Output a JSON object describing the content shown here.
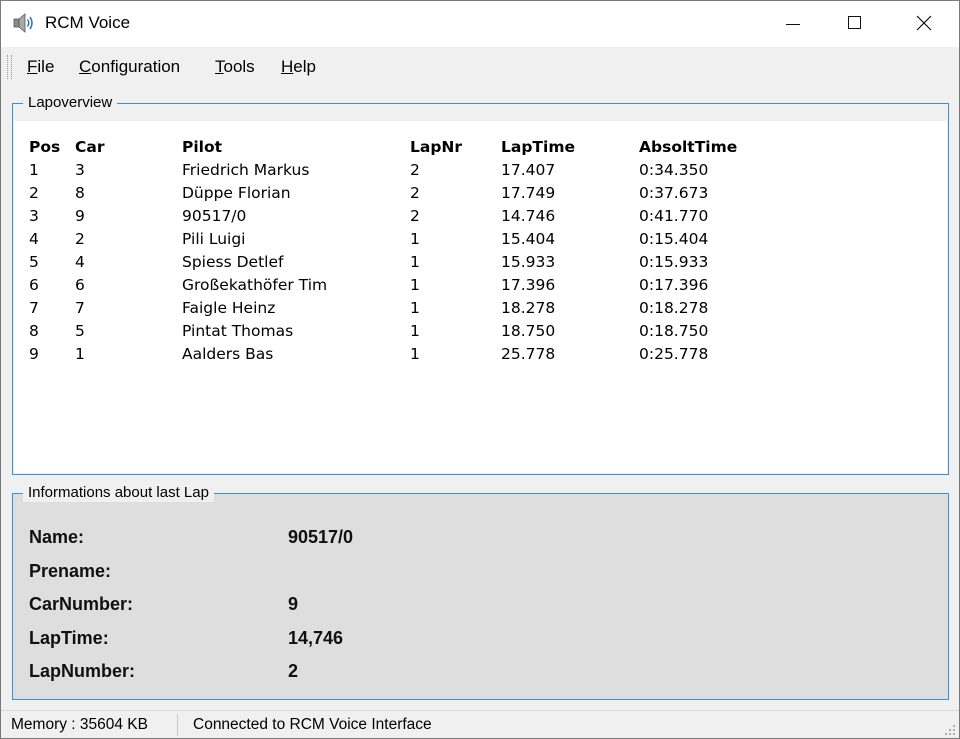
{
  "window": {
    "title": "RCM Voice",
    "icon": "speaker-icon"
  },
  "menu": [
    "File",
    "Configuration",
    "Tools",
    "Help"
  ],
  "lapoverview": {
    "label": "Lapoverview",
    "columns": [
      "Pos",
      "Car",
      "Pilot",
      "LapNr",
      "LapTime",
      "AbsoltTime"
    ],
    "rows": [
      [
        "1",
        "3",
        "Friedrich Markus",
        "2",
        "17.407",
        "0:34.350"
      ],
      [
        "2",
        "8",
        "Düppe Florian",
        "2",
        "17.749",
        "0:37.673"
      ],
      [
        "3",
        "9",
        "90517/0",
        "2",
        "14.746",
        "0:41.770"
      ],
      [
        "4",
        "2",
        "Pili Luigi",
        "1",
        "15.404",
        "0:15.404"
      ],
      [
        "5",
        "4",
        "Spiess Detlef",
        "1",
        "15.933",
        "0:15.933"
      ],
      [
        "6",
        "6",
        "Großekathöfer Tim",
        "1",
        "17.396",
        "0:17.396"
      ],
      [
        "7",
        "7",
        "Faigle Heinz",
        "1",
        "18.278",
        "0:18.278"
      ],
      [
        "8",
        "5",
        "Pintat Thomas",
        "1",
        "18.750",
        "0:18.750"
      ],
      [
        "9",
        "1",
        "Aalders Bas",
        "1",
        "25.778",
        "0:25.778"
      ]
    ]
  },
  "last_lap": {
    "label": "Informations about last Lap",
    "fields": [
      {
        "label": "Name:",
        "value": "90517/0"
      },
      {
        "label": "Prename:",
        "value": ""
      },
      {
        "label": "CarNumber:",
        "value": "9"
      },
      {
        "label": "LapTime:",
        "value": "14,746"
      },
      {
        "label": "LapNumber:",
        "value": "2"
      }
    ]
  },
  "status": {
    "memory": "Memory : 35604 KB",
    "connection": "Connected to RCM Voice Interface"
  },
  "colors": {
    "group_border": "#3b8fd6",
    "info_background": "#dedede"
  }
}
